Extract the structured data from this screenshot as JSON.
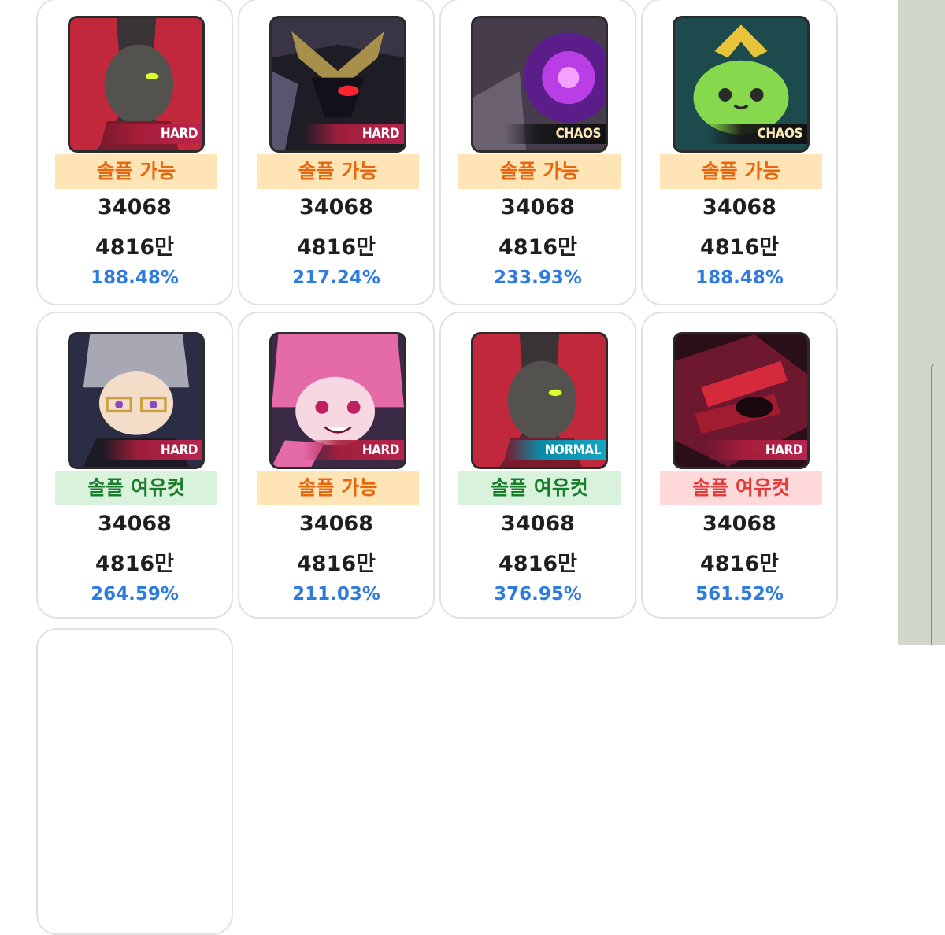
{
  "bosses": [
    {
      "difficulty": "HARD",
      "status": "솔플 가능",
      "value": "34068",
      "amount": "4816만",
      "percent": "188.48%"
    },
    {
      "difficulty": "HARD",
      "status": "솔플 가능",
      "value": "34068",
      "amount": "4816만",
      "percent": "217.24%"
    },
    {
      "difficulty": "CHAOS",
      "status": "솔플 가능",
      "value": "34068",
      "amount": "4816만",
      "percent": "233.93%"
    },
    {
      "difficulty": "CHAOS",
      "status": "솔플 가능",
      "value": "34068",
      "amount": "4816만",
      "percent": "188.48%"
    },
    {
      "difficulty": "HARD",
      "status": "솔플 여유컷",
      "value": "34068",
      "amount": "4816만",
      "percent": "264.59%"
    },
    {
      "difficulty": "HARD",
      "status": "솔플 가능",
      "value": "34068",
      "amount": "4816만",
      "percent": "211.03%"
    },
    {
      "difficulty": "NORMAL",
      "status": "솔플 여유컷",
      "value": "34068",
      "amount": "4816만",
      "percent": "376.95%"
    },
    {
      "difficulty": "HARD",
      "status": "솔플 여유컷",
      "value": "34068",
      "amount": "4816만",
      "percent": "561.52%"
    }
  ],
  "colors": {
    "status_possible_bg": "#ffe4b5",
    "status_possible_text": "#e8670e",
    "status_ease_green_bg": "#d8f2dc",
    "status_ease_green_text": "#1a7c2c",
    "status_ease_red_bg": "#ffd9da",
    "status_ease_red_text": "#e33a3a",
    "percent_text": "#2e7be0"
  }
}
